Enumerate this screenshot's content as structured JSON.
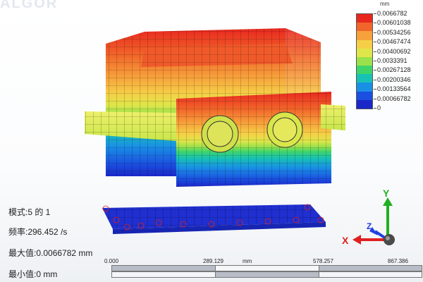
{
  "viewer": {
    "watermark": "ALGOR",
    "colors": {
      "background": "#ffffff",
      "max_color": "#e8281f",
      "min_color": "#1b27c8"
    }
  },
  "legend": {
    "unit": "mm",
    "values": [
      "0.0066782",
      "0.00601038",
      "0.00534256",
      "0.00467474",
      "0.00400692",
      "0.0033391",
      "0.00267128",
      "0.00200346",
      "0.00133564",
      "0.00066782",
      "0"
    ],
    "colors": [
      "#e8281f",
      "#f2652a",
      "#f7a13b",
      "#f6cf47",
      "#dfe64a",
      "#9ae14b",
      "#3fd46a",
      "#17c2b5",
      "#1a8fe6",
      "#1b4fe0",
      "#1b27c8"
    ]
  },
  "info": {
    "mode": "模式:5 的 1",
    "frequency": "频率:296.452 /s",
    "max_value": "最大值:0.0066782 mm",
    "min_value": "最小值:0 mm"
  },
  "scalebar": {
    "ticks": [
      "0.000",
      "289.129",
      "578.257",
      "867.386"
    ],
    "unit": "mm"
  },
  "triad": {
    "x_label": "X",
    "y_label": "Y",
    "z_label": "Z",
    "x_color": "#e02020",
    "y_color": "#20b020",
    "z_color": "#2040e0"
  }
}
